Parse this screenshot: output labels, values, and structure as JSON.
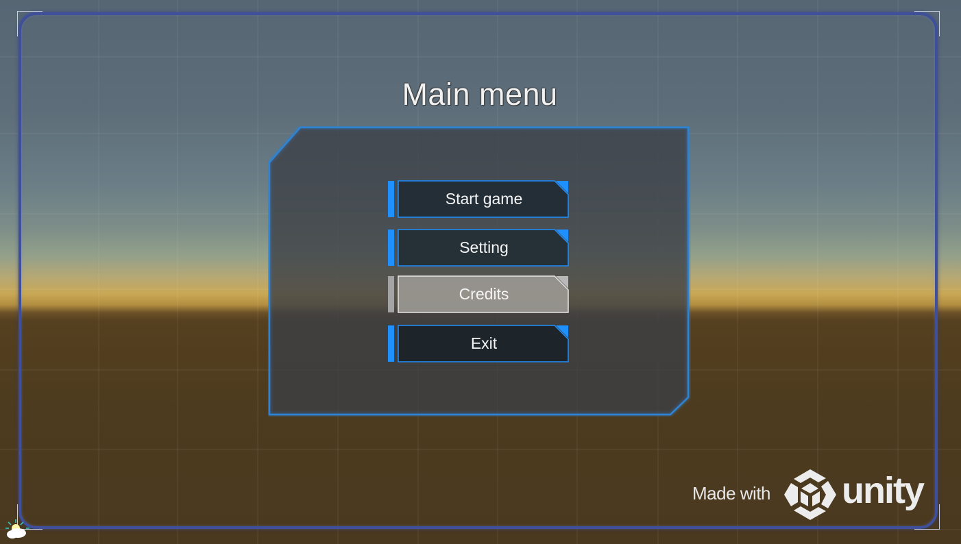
{
  "menu": {
    "title": "Main menu",
    "buttons": [
      {
        "id": "start",
        "label": "Start game",
        "state": "normal"
      },
      {
        "id": "setting",
        "label": "Setting",
        "state": "normal"
      },
      {
        "id": "credits",
        "label": "Credits",
        "state": "highlighted"
      },
      {
        "id": "exit",
        "label": "Exit",
        "state": "normal"
      }
    ]
  },
  "branding": {
    "made_with": "Made with",
    "engine_name": "unity",
    "logo_icon": "unity-cube-logo"
  },
  "editor": {
    "light_icon": "directional-light-gizmo-icon"
  },
  "colors": {
    "accent_blue": "#1e90ff",
    "panel_border": "#2f7fc8",
    "button_fill": "#1f2a33",
    "highlight_fill": "#9a9893",
    "frame_border": "#3f4f9a",
    "text": "#f4f4f4"
  }
}
